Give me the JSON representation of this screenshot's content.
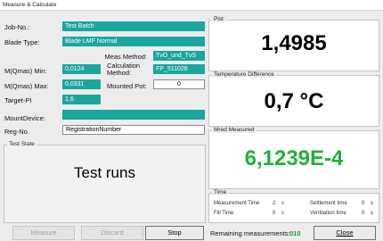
{
  "window": {
    "title": "Measure & Calculate"
  },
  "fields": {
    "job_no": {
      "label": "Job-No.:",
      "value": "Test Batch"
    },
    "blade_type": {
      "label": "Blade Type:",
      "value": "Blade LMF Normal"
    },
    "meas_method": {
      "label": "Meas Method:",
      "value": "TvO_und_TvS"
    },
    "mqmas_min": {
      "label": "M(Qmas) Min:",
      "value": "0,0124"
    },
    "calc_method": {
      "label": "Calculation Method:",
      "value": "FP_511026"
    },
    "mqmas_max": {
      "label": "M(Qmas) Max:",
      "value": "0,0331"
    },
    "mounted_pot": {
      "label": "Mounted Pot:",
      "value": "0"
    },
    "target_pi": {
      "label": "Target-PI",
      "value": "1,6"
    },
    "mount_device": {
      "label": "MountDevice:",
      "value": ""
    },
    "reg_no": {
      "label": "Reg-No.",
      "value": "RegistrationNumber"
    }
  },
  "test_state": {
    "title": "Test State",
    "value": "Test runs"
  },
  "pist": {
    "title": "Pist",
    "value": "1,4985"
  },
  "temp_diff": {
    "title": "Temperature Difference",
    "value": "0,7 °C"
  },
  "mred": {
    "title": "Mred Measured",
    "value": "6,1239E-4",
    "color": "#22b03a"
  },
  "time": {
    "title": "Time",
    "measurement_time": {
      "label": "Measurement Time",
      "value": "2",
      "unit": "s"
    },
    "settlement_time": {
      "label": "Settlement time",
      "value": "0",
      "unit": "s"
    },
    "fill_time": {
      "label": "Fill Time",
      "value": "0",
      "unit": "s"
    },
    "ventilation_time": {
      "label": "Ventilation time",
      "value": "0",
      "unit": "s"
    }
  },
  "buttons": {
    "measure": "Measure",
    "discard": "Discard",
    "stop": "Stop",
    "close": "Close"
  },
  "remaining": {
    "label": "Remaining measurements:",
    "value": "010"
  },
  "colors": {
    "field_teal": "#1aa69e",
    "remaining_value": "#1a9a2a",
    "mred_value": "#22b03a"
  }
}
